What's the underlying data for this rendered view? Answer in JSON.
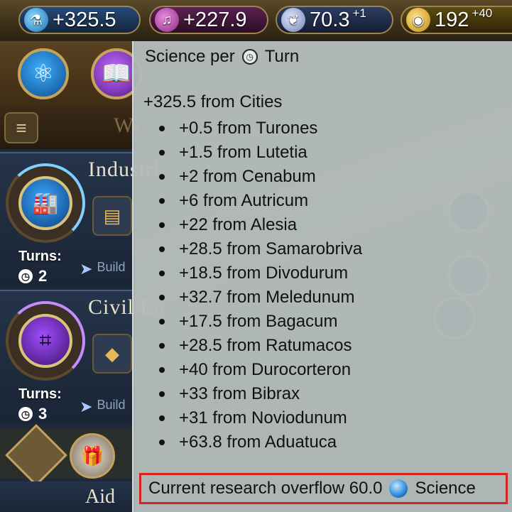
{
  "resources": {
    "science": {
      "value": "+325.5",
      "icon": "science-flask-icon"
    },
    "culture": {
      "value": "+227.9",
      "icon": "culture-note-icon"
    },
    "faith": {
      "value": "70.3",
      "delta": "+1",
      "icon": "faith-icon"
    },
    "gold": {
      "value": "192",
      "delta": "+40",
      "icon": "gold-coin-icon"
    }
  },
  "left_panel": {
    "menu_word": "Wo",
    "techs": [
      {
        "name": "Industrialization",
        "visible_name": "Industri",
        "turns_label": "Turns:",
        "turns": "2",
        "build_label": "Build"
      },
      {
        "name": "Civil Engineering",
        "visible_name": "Civil En",
        "turns_label": "Turns:",
        "turns": "3",
        "build_label": "Build"
      }
    ],
    "bottom_label": "Aid"
  },
  "tooltip": {
    "title_prefix": "Science per",
    "title_suffix": "Turn",
    "total_line": "+325.5 from Cities",
    "cities": [
      "+0.5 from Turones",
      "+1.5 from Lutetia",
      "+2 from Cenabum",
      "+6 from Autricum",
      "+22 from Alesia",
      "+28.5 from Samarobriva",
      "+18.5 from Divodurum",
      "+32.7 from Meledunum",
      "+17.5 from Bagacum",
      "+28.5 from Ratumacos",
      "+40 from Durocorteron",
      "+33 from Bibrax",
      "+31 from Noviodunum",
      "+63.8 from Aduatuca"
    ],
    "overflow_text": "Current research overflow 60.0",
    "overflow_unit": "Science"
  },
  "colors": {
    "highlight": "#d42424",
    "science": "#2a86d8"
  }
}
